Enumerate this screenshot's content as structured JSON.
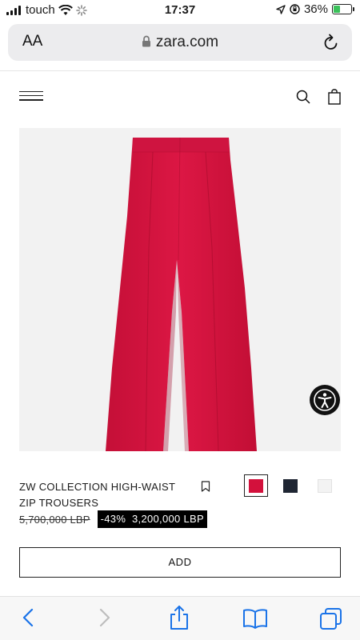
{
  "status_bar": {
    "carrier": "touch",
    "time": "17:37",
    "battery_percent": "36%",
    "battery_level": 0.36
  },
  "browser": {
    "text_size_label": "AA",
    "url": "zara.com"
  },
  "product": {
    "name_line1": "ZW COLLECTION HIGH-WAIST",
    "name_line2": "ZIP TROUSERS",
    "old_price": "5,700,000 LBP",
    "discount": "-43%",
    "sale_price": "3,200,000 LBP",
    "add_button_label": "ADD",
    "colors": [
      {
        "name": "red",
        "hex": "#d3113c",
        "selected": true
      },
      {
        "name": "navy",
        "hex": "#1f2633",
        "selected": false
      },
      {
        "name": "white",
        "hex": "#f3f3f3",
        "selected": false
      }
    ]
  },
  "theme": {
    "product_red": "#d3113c",
    "sale_box": "#000000",
    "battery_green": "#3ac15a"
  },
  "icons": [
    "signal-icon",
    "wifi-icon",
    "loading-icon",
    "location-icon",
    "lock-icon",
    "reload-icon",
    "menu-icon",
    "search-icon",
    "bag-icon",
    "accessibility-icon",
    "bookmark-icon",
    "back-icon",
    "forward-icon",
    "share-icon",
    "bookmarks-icon",
    "tabs-icon"
  ]
}
